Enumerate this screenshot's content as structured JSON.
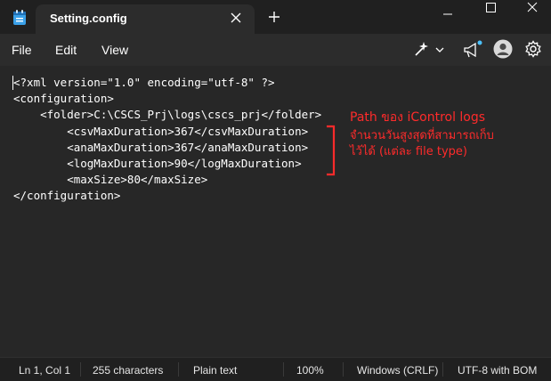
{
  "titlebar": {
    "tab_title": "Setting.config",
    "icons": {
      "app": "notepad-icon",
      "close_tab": "close-icon",
      "new_tab": "plus-icon",
      "minimize": "minimize-icon",
      "maximize": "maximize-icon",
      "close_window": "close-icon"
    }
  },
  "menu": {
    "file": "File",
    "edit": "Edit",
    "view": "View",
    "icons": {
      "copilot": "copilot-sparkle-icon",
      "dropdown": "chevron-down-icon",
      "feedback": "megaphone-icon",
      "account": "account-avatar-icon",
      "settings": "gear-icon"
    }
  },
  "editor": {
    "lines": [
      "<?xml version=\"1.0\" encoding=\"utf-8\" ?>",
      "<configuration>",
      "    <folder>C:\\CSCS_Prj\\logs\\cscs_prj</folder>",
      "        <csvMaxDuration>367</csvMaxDuration>",
      "        <anaMaxDuration>367</anaMaxDuration>",
      "        <logMaxDuration>90</logMaxDuration>",
      "        <maxSize>80</maxSize>",
      "</configuration>"
    ]
  },
  "annotations": {
    "path_note": "Path ของ iControl logs",
    "duration_note_1": "จำนวนวันสูงสุดที่สามารถเก็บ",
    "duration_note_2": "ไว้ได้ (แต่ละ file type)",
    "color": "#ff2b2b"
  },
  "status": {
    "position": "Ln 1, Col 1",
    "characters": "255 characters",
    "format": "Plain text",
    "zoom": "100%",
    "line_ending": "Windows (CRLF)",
    "encoding": "UTF-8 with BOM"
  }
}
